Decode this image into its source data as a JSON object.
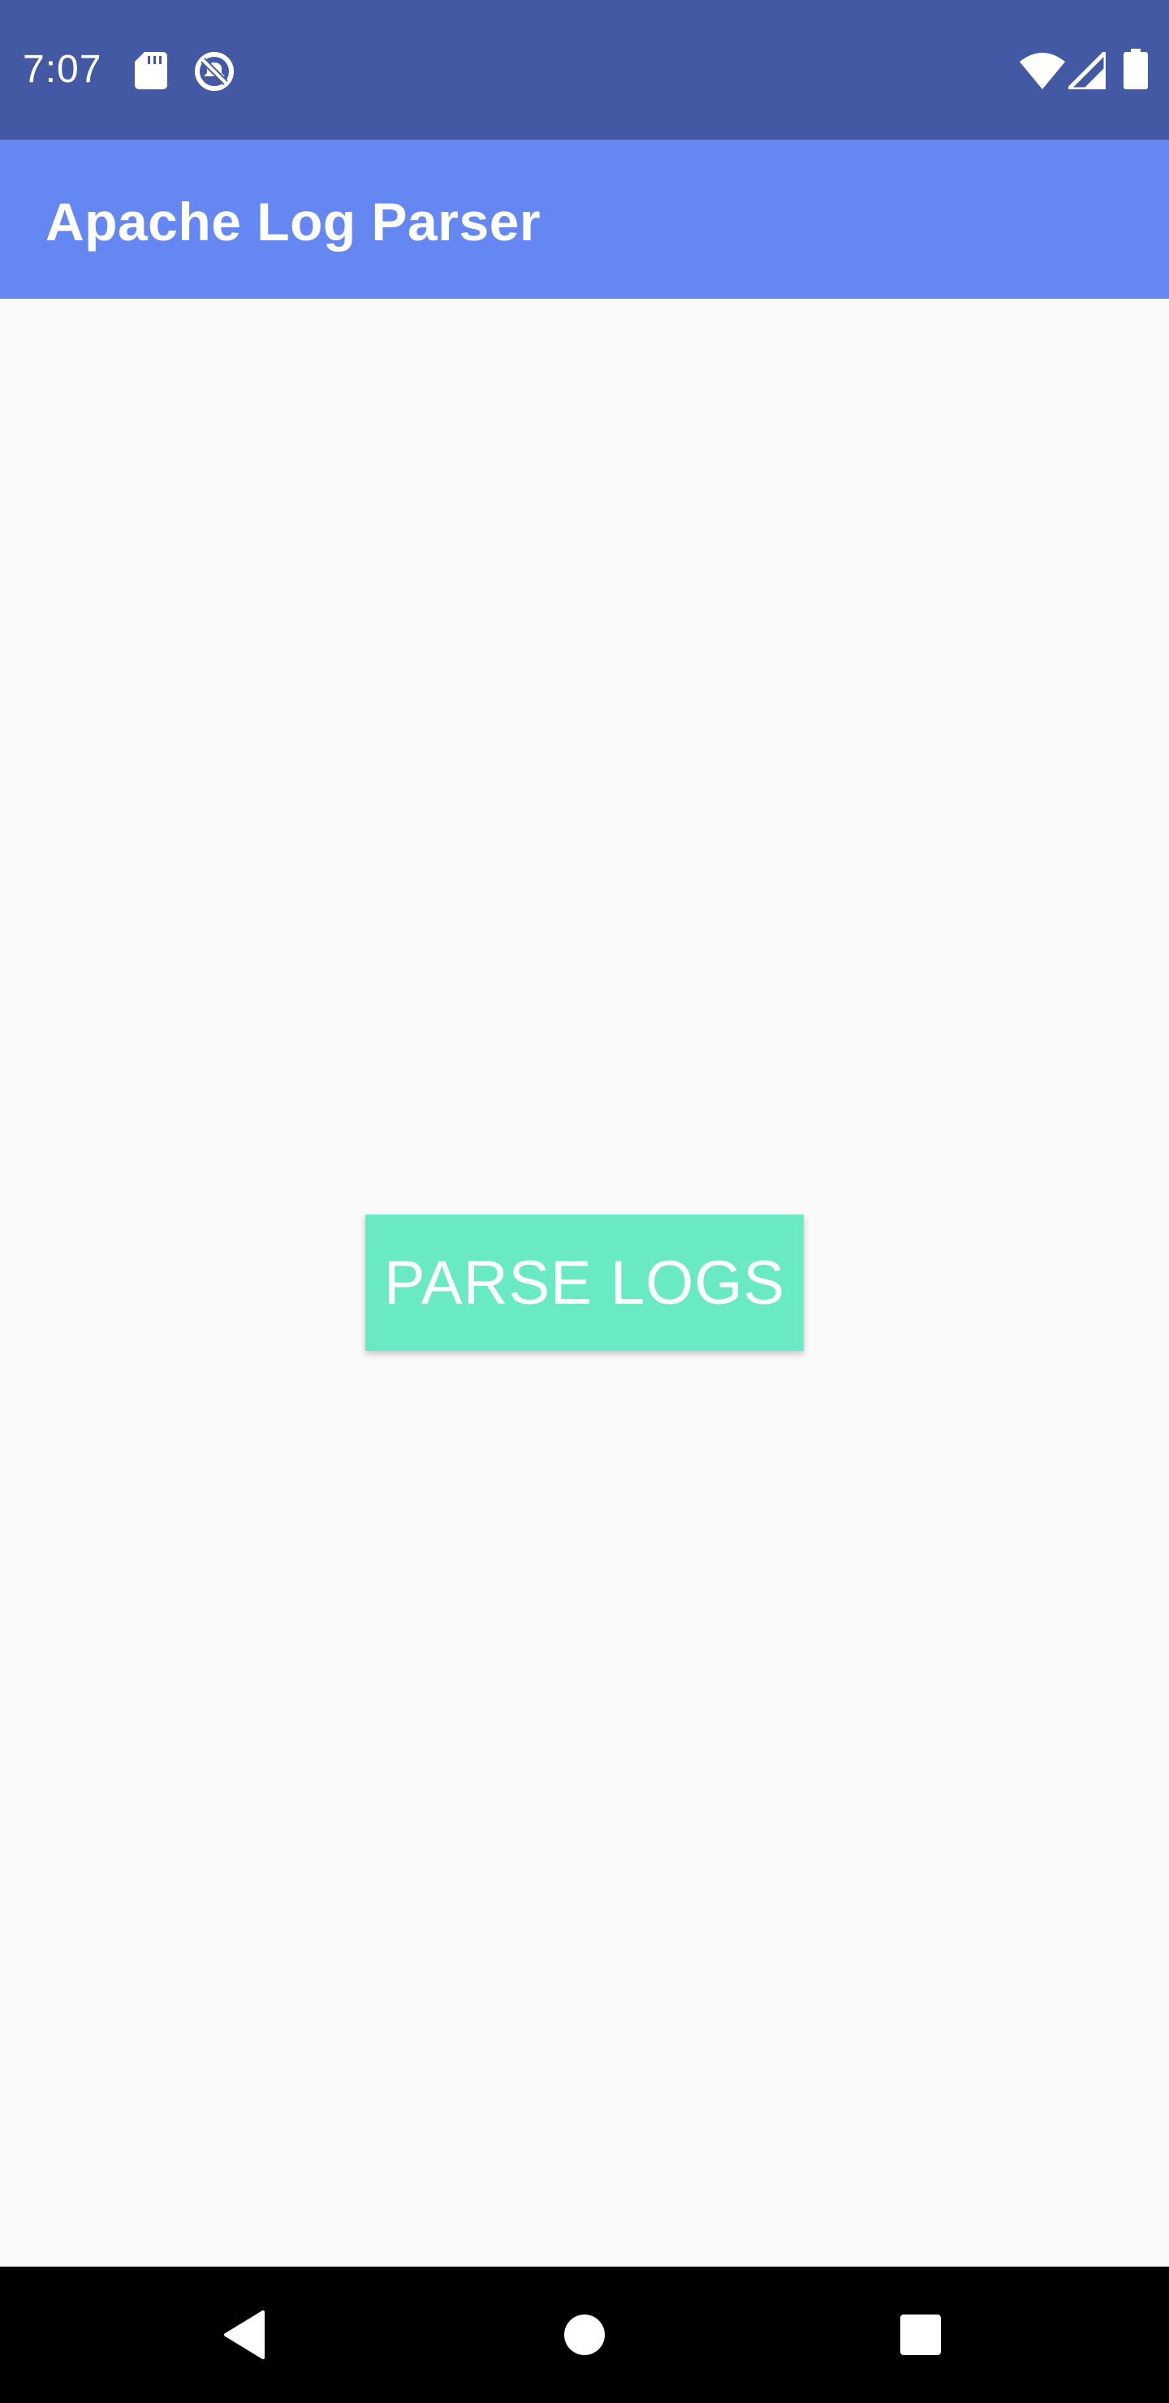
{
  "status_bar": {
    "time": "7:07",
    "icons": [
      "sd-card-icon",
      "do-not-disturb-icon",
      "wifi-icon",
      "cell-signal-icon",
      "battery-icon"
    ]
  },
  "app_bar": {
    "title": "Apache Log Parser"
  },
  "main": {
    "parse_button_label": "PARSE LOGS"
  },
  "nav_bar": {
    "icons": [
      "back-icon",
      "home-icon",
      "recents-icon"
    ]
  },
  "colors": {
    "status_bar": "#4459a3",
    "app_bar": "#6587f1",
    "background": "#fafafa",
    "button": "#69e9c4",
    "nav_bar": "#000000"
  }
}
